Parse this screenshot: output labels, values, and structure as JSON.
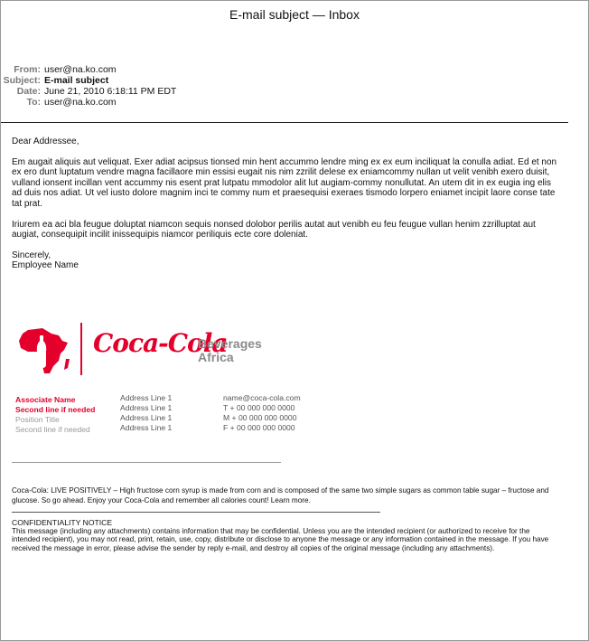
{
  "window": {
    "title": "E-mail subject — Inbox"
  },
  "headers": {
    "from_label": "From:",
    "from": "user@na.ko.com",
    "subject_label": "Subject:",
    "subject": "E-mail subject",
    "date_label": "Date:",
    "date": "June 21, 2010 6:18:11 PM EDT",
    "to_label": "To:",
    "to": "user@na.ko.com"
  },
  "message": {
    "greeting": "Dear Addressee,",
    "paragraph1": "Em augait aliquis aut veliquat. Exer adiat acipsus tionsed min hent accummo lendre ming ex ex eum inciliquat la conulla adiat. Ed et non ex ero dunt luptatum vendre magna facillaore min essisi eugait nis nim zzrilit delese ex eniamcommy nullan ut velit venibh exero duisit, vulland ionsent incillan vent accummy nis esent prat lutpatu mmodolor alit lut augiam-commy nonullutat. An utem dit in ex eugia ing elis ad duis nos adiat. Ut vel iusto dolore magnim inci te commy num et praesequisi exeraes tismodo lorpero eniamet incipit laore conse tate tat prat.",
    "paragraph2": "Iriurem ea aci bla feugue doluptat niamcon sequis nonsed dolobor perilis autat aut venibh eu feu feugue vullan henim zzrilluptat aut augiat, consequipit incilit inissequipis niamcor periliquis ecte core doleniat.",
    "closing": "Sincerely,",
    "sender": "Employee Name"
  },
  "signature": {
    "brand": "Coca-Cola",
    "division_line1": "Beverages",
    "division_line2": "Africa",
    "associate_name": "Associate Name",
    "associate_second": "Second line if needed",
    "position_title": "Position Title",
    "position_second": "Second line if needed",
    "address": [
      "Address Line 1",
      "Address Line 1",
      "Address Line 1",
      "Address Line 1"
    ],
    "email": "name@coca-cola.com",
    "phone_t": "T  + 00 000 000 0000",
    "phone_m": "M + 00 000 000 0000",
    "phone_f": "F  + 00 000 000 0000",
    "brand_red": "#e4002b"
  },
  "footer": {
    "tagline": "Coca-Cola: LIVE POSITIVELY – High fructose corn syrup is made from corn and is composed of the same two simple sugars as common table sugar – fructose and glucose. So go ahead. Enjoy your Coca-Cola and remember all calories count! Learn more.",
    "confidentiality_title": "CONFIDENTIALITY NOTICE",
    "confidentiality_text": "This message (including any attachments) contains information that may be confidential.  Unless you are the intended recipient (or authorized to receive for the intended recipient), you may not read, print, retain, use, copy, distribute or disclose to anyone the message or any information contained in the message.  If you have received the message in error, please advise the sender by reply e-mail, and destroy all copies of the original message (including any attachments)."
  }
}
